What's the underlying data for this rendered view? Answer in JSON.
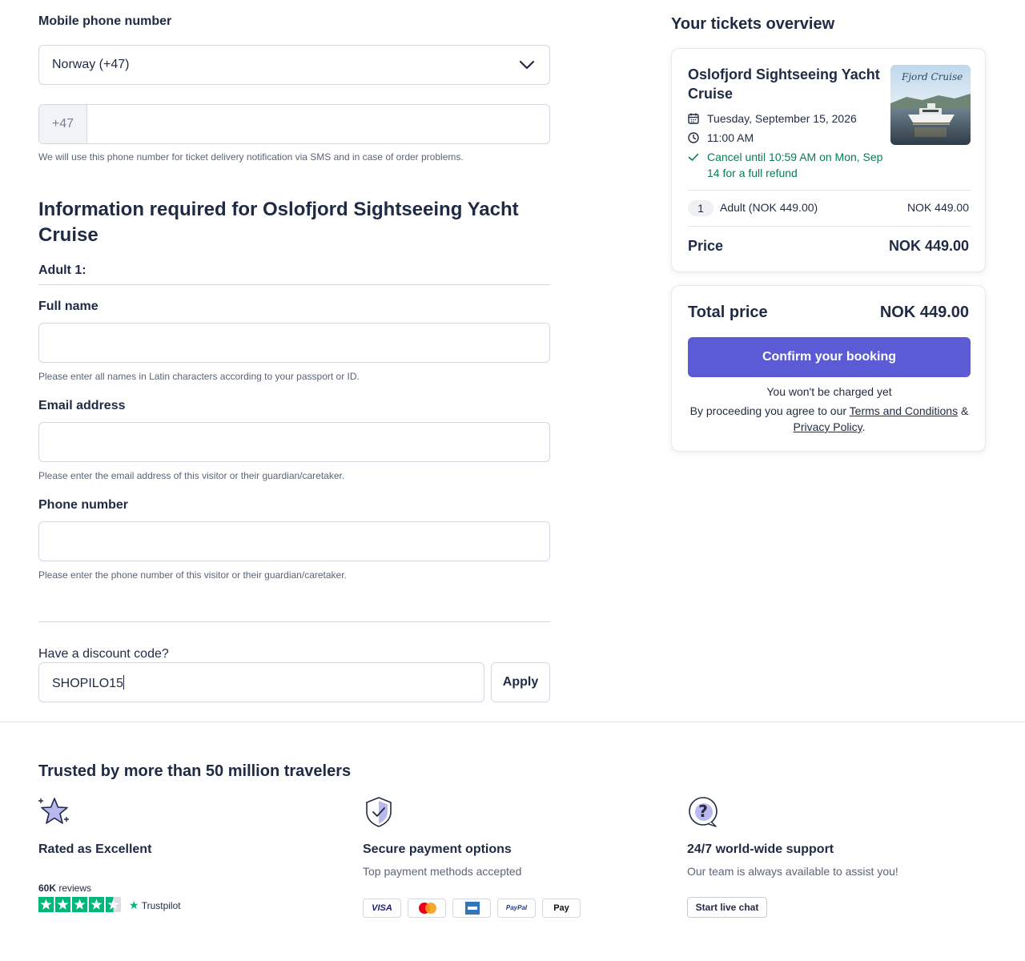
{
  "contact": {
    "mobile_label": "Mobile phone number",
    "country_value": "Norway (+47)",
    "prefix": "+47",
    "phone_value": "",
    "phone_hint": "We will use this phone number for ticket delivery notification via SMS and in case of order problems."
  },
  "info": {
    "heading": "Information required for Oslofjord Sightseeing Yacht Cruise",
    "adult_label": "Adult 1:",
    "full_name_label": "Full name",
    "full_name_value": "",
    "full_name_hint": "Please enter all names in Latin characters according to your passport or ID.",
    "email_label": "Email address",
    "email_value": "",
    "email_hint": "Please enter the email address of this visitor or their guardian/caretaker.",
    "phone_label": "Phone number",
    "phone_value": "",
    "phone_hint": "Please enter the phone number of this visitor or their guardian/caretaker."
  },
  "discount": {
    "label": "Have a discount code?",
    "value": "SHOPILO15",
    "apply_label": "Apply"
  },
  "overview": {
    "heading": "Your tickets overview",
    "tour_title": "Oslofjord Sightseeing Yacht Cruise",
    "date": "Tuesday, September 15, 2026",
    "time": "11:00 AM",
    "cancel": "Cancel until 10:59 AM on Mon, Sep 14 for a full refund",
    "thumb_text": "Fjord Cruise",
    "qty": "1",
    "ticket_type": "Adult  (NOK 449.00)",
    "ticket_total": "NOK 449.00",
    "price_label": "Price",
    "price_value": "NOK 449.00"
  },
  "checkout": {
    "total_label": "Total price",
    "total_value": "NOK 449.00",
    "confirm_label": "Confirm your booking",
    "not_charged": "You won't be charged yet",
    "agree_prefix": "By proceeding you agree to our ",
    "terms_link": "Terms and Conditions",
    "amp": " &",
    "privacy_link": "Privacy Policy",
    "period": "."
  },
  "footer": {
    "trusted_heading": "Trusted by more than 50 million travelers",
    "features": [
      {
        "title": "Rated as Excellent",
        "subtitle": "",
        "icon": "star-sparkle-icon"
      },
      {
        "title": "Secure payment options",
        "subtitle": "Top payment methods accepted",
        "icon": "shield-check-icon"
      },
      {
        "title": "24/7 world-wide support",
        "subtitle": "Our team is always available to assist you!",
        "icon": "question-chat-icon"
      }
    ],
    "reviews_count": "60K",
    "reviews_word": " reviews",
    "trustpilot": "Trustpilot",
    "rating_stars": 4.5,
    "payments": [
      "VISA",
      "Mastercard",
      "Amex",
      "PayPal",
      "Pay"
    ],
    "live_chat_label": "Start live chat"
  },
  "colors": {
    "primary": "#5b5bd6",
    "text": "#1f2a44",
    "success": "#0a7a55",
    "trustpilot": "#00b67a"
  }
}
